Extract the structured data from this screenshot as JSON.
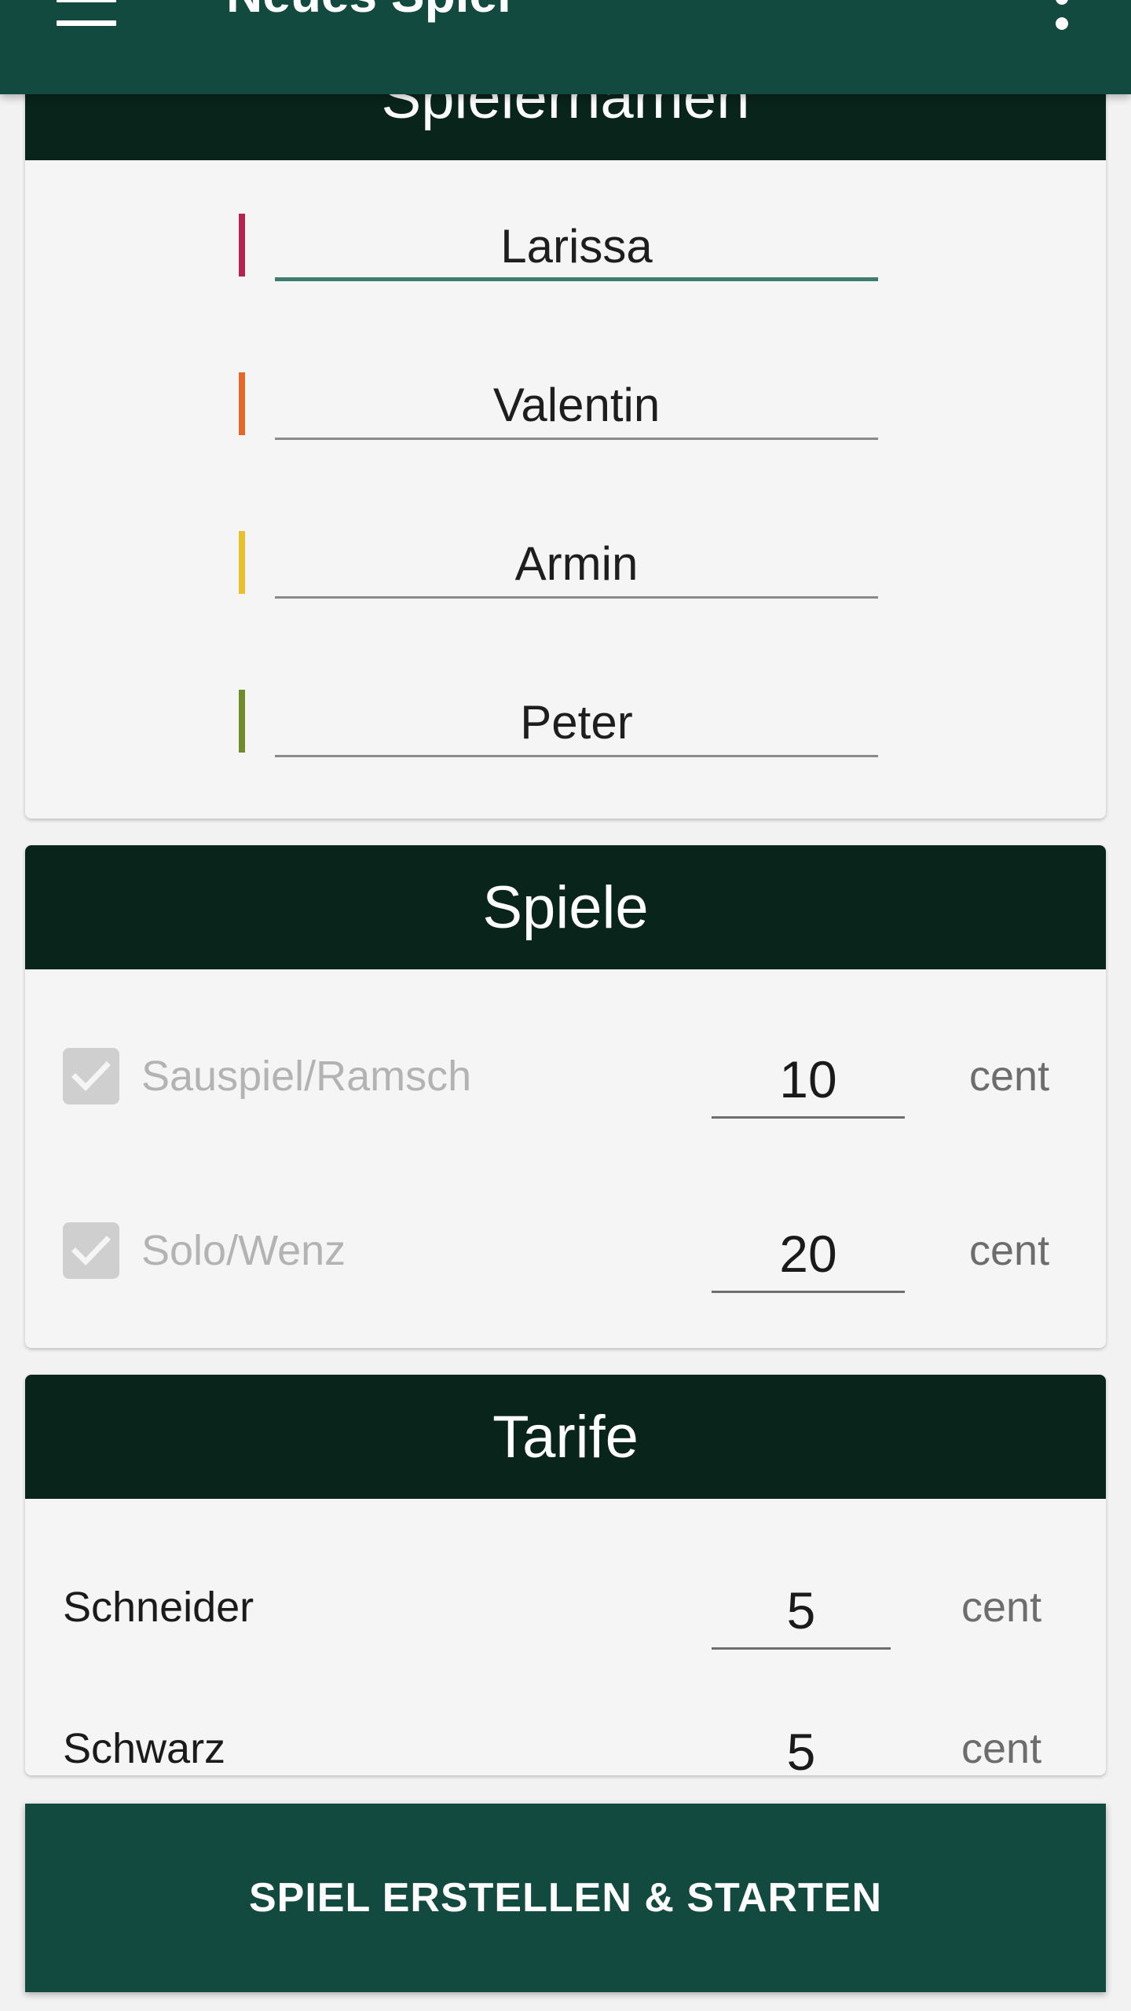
{
  "appbar": {
    "title": "Neues Spiel",
    "menu_icon": "hamburger-menu-icon",
    "more_icon": "more-vert-icon"
  },
  "players_card": {
    "header": "Spielernamen",
    "players": [
      {
        "name": "Larissa",
        "color": "#b3244f"
      },
      {
        "name": "Valentin",
        "color": "#e2692b"
      },
      {
        "name": "Armin",
        "color": "#e6c02f"
      },
      {
        "name": "Peter",
        "color": "#6f8b2c"
      }
    ]
  },
  "games_card": {
    "header": "Spiele",
    "rows": [
      {
        "label": "Sauspiel/Ramsch",
        "checked": true,
        "value": "10",
        "unit": "cent"
      },
      {
        "label": "Solo/Wenz",
        "checked": true,
        "value": "20",
        "unit": "cent"
      }
    ]
  },
  "tariffs_card": {
    "header": "Tarife",
    "rows": [
      {
        "label": "Schneider",
        "value": "5",
        "unit": "cent"
      },
      {
        "label": "Schwarz",
        "value": "5",
        "unit": "cent"
      }
    ]
  },
  "start_button": {
    "label": "SPIEL ERSTELLEN & STARTEN"
  },
  "colors": {
    "appbar": "#124a3f",
    "card_header": "#09241b",
    "active_underline": "#3e7d6e"
  }
}
